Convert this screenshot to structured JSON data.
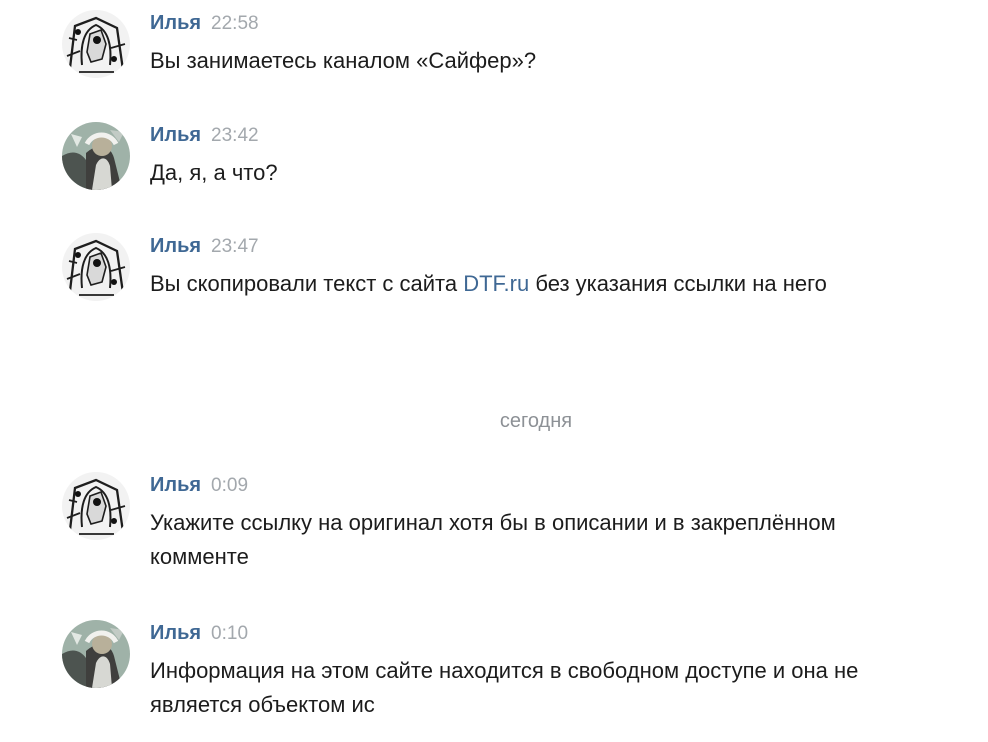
{
  "messages": [
    {
      "author": "Илья",
      "time": "22:58",
      "text": "Вы занимаетесь каналом «Сайфер»?"
    },
    {
      "author": "Илья",
      "time": "23:42",
      "text": "Да, я, а что?"
    },
    {
      "author": "Илья",
      "time": "23:47",
      "text_before": "Вы скопировали текст с сайта ",
      "link": "DTF.ru",
      "text_after": " без указания ссылки на него"
    },
    {
      "author": "Илья",
      "time": "0:09",
      "text": "Укажите ссылку на оригинал хотя бы в описании и в закреплённом комменте"
    },
    {
      "author": "Илья",
      "time": "0:10",
      "text": "Информация на этом сайте находится в свободном доступе и она не является объектом ис"
    }
  ],
  "date_separator": "сегодня",
  "colors": {
    "author": "#3f6894",
    "time": "#a3a8ad",
    "text": "#1c1c1c",
    "separator": "#8d9196"
  },
  "icons": {
    "avatar_a": "sketch-avatar-icon",
    "avatar_b": "photo-avatar-icon"
  }
}
